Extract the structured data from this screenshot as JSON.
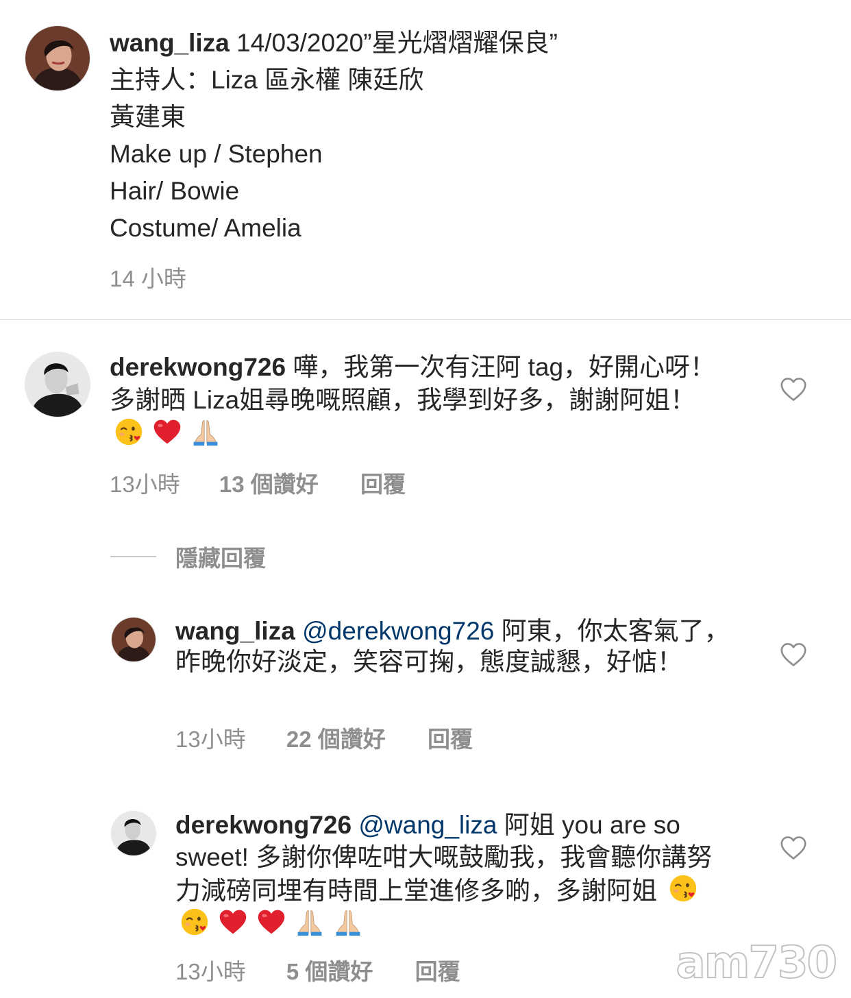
{
  "post": {
    "username": "wang_liza",
    "caption_first": "14/03/2020”星光熠熠耀保良”",
    "caption_lines": [
      "主持人：Liza  區永權  陳廷欣",
      "黃建東",
      "Make up / Stephen",
      "Hair/ Bowie",
      "Costume/ Amelia"
    ],
    "time": "14 小時"
  },
  "comment1": {
    "username": "derekwong726",
    "text": "嘩，我第一次有汪阿 tag，好開心呀！多謝晒 Liza姐尋晚嘅照顧，我學到好多，謝謝阿姐！",
    "emojis": [
      "kiss-emoji",
      "heart-emoji",
      "pray-emoji"
    ],
    "time": "13小時",
    "likes": "13 個讚好",
    "reply": "回覆"
  },
  "hide_replies": "隱藏回覆",
  "reply1": {
    "username": "wang_liza",
    "mention": "@derekwong726",
    "text": "阿東，你太客氣了，昨晚你好淡定，笑容可掬，態度誠懇，好惦！",
    "time": "13小時",
    "likes": "22 個讚好",
    "reply": "回覆"
  },
  "reply2": {
    "username": "derekwong726",
    "mention": "@wang_liza",
    "text": "阿姐 you are so sweet! 多謝你俾咗咁大嘅鼓勵我，我會聽你講努力減磅同埋有時間上堂進修多啲，多謝阿姐",
    "emojis": [
      "kiss-emoji",
      "kiss-emoji",
      "heart-emoji",
      "heart-emoji",
      "pray-emoji",
      "pray-emoji"
    ],
    "time": "13小時",
    "likes": "5 個讚好",
    "reply": "回覆"
  },
  "watermark": "am730",
  "colors": {
    "text": "#262626",
    "secondary": "#8e8e8e",
    "mention": "#00376b",
    "divider": "#dbdbdb"
  }
}
